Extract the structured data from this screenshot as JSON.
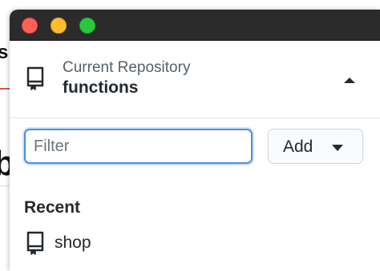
{
  "window": {
    "traffic_lights": [
      "close",
      "minimize",
      "maximize"
    ],
    "colors": {
      "close": "#fe5f57",
      "minimize": "#febc2e",
      "maximize": "#28c840",
      "titlebar": "#2b2b2c"
    }
  },
  "repository_header": {
    "subtitle": "Current Repository",
    "title": "functions",
    "icon": "repo-icon",
    "toggle_icon": "caret-up-icon"
  },
  "filter": {
    "placeholder": "Filter",
    "value": ""
  },
  "add_button": {
    "label": "Add",
    "icon": "caret-down-icon"
  },
  "recent": {
    "title": "Recent",
    "items": [
      {
        "label": "shop",
        "icon": "repo-icon"
      }
    ]
  },
  "accent_color": "#4a90e2"
}
